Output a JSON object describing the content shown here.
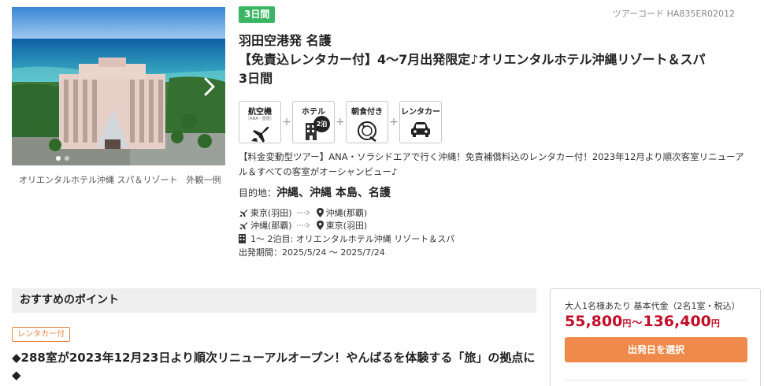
{
  "hero": {
    "caption": "オリエンタルホテル沖縄 スパ＆リゾート　外観一例",
    "slide_count": 2,
    "active_slide": 1
  },
  "tour": {
    "days_badge": "3日間",
    "code": "ツアーコード HA835ER02012",
    "title_line1": "羽田空港発 名護",
    "title_line2": "【免責込レンタカー付】4～7月出発限定♪オリエンタルホテル沖縄リゾート＆スパ",
    "title_line3": "3日間"
  },
  "includes": [
    {
      "label": "航空機",
      "sub": "［ANA・直便］",
      "icon": "airplane-icon"
    },
    {
      "label": "ホテル",
      "badge": "2泊",
      "icon": "hotel-icon"
    },
    {
      "label": "朝食付き",
      "icon": "meal-icon"
    },
    {
      "label": "レンタカー",
      "icon": "car-icon"
    }
  ],
  "description": "【料金変動型ツアー】ANA・ソラシドエアで行く沖縄！免責補償料込のレンタカー付！2023年12月より順次客室リニューアル＆すべての客室がオーシャンビュー♪",
  "destination": {
    "label": "目的地：",
    "value": "沖縄、沖縄 本島、名護"
  },
  "itinerary": [
    {
      "from": "東京(羽田)",
      "to": "沖縄(那覇)"
    },
    {
      "from": "沖縄(那覇)",
      "to": "東京(羽田)"
    }
  ],
  "hotel_stay": "1～ 2泊目: オリエンタルホテル沖縄 リゾート＆スパ",
  "departure_period": "出発期間：2025/5/24 ～ 2025/7/24",
  "points": {
    "heading": "おすすめのポイント",
    "tag": "レンタカー付",
    "headline": "◆288室が2023年12月23日より順次リニューアルオープン！やんばるを体験する「旅」の拠点に◆"
  },
  "price": {
    "label": "大人1名様あたり 基本代金（2名1室・税込）",
    "min": "55,800",
    "max": "136,400",
    "currency": "円",
    "separator": "～",
    "cta": "出発日を選択",
    "color": "#c0102a",
    "cta_color": "#f08a4a"
  },
  "colors": {
    "badge_green": "#3ab563",
    "tag_orange": "#e8853d"
  }
}
